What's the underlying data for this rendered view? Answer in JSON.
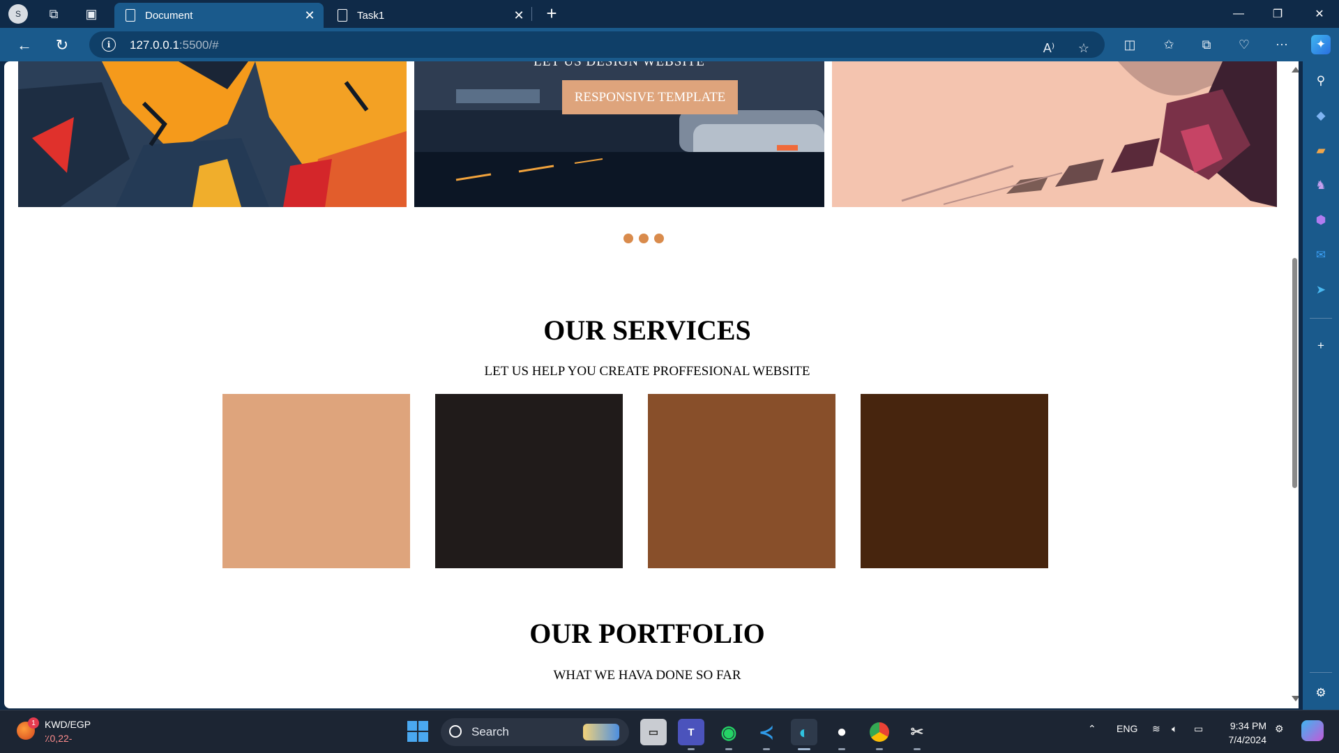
{
  "browser": {
    "profile_initial": "S",
    "tabs": [
      {
        "title": "Document",
        "active": true
      },
      {
        "title": "Task1",
        "active": false
      }
    ],
    "url_host": "127.0.0.1",
    "url_rest": ":5500/#"
  },
  "page": {
    "slider": {
      "slide_title": "LET US DESIGN WEBSITE",
      "button_label": "RESPONSIVE TEMPLATE",
      "dot_count": 3
    },
    "services": {
      "title": "OUR SERVICES",
      "subtitle": "LET US HELP YOU CREATE PROFFESIONAL WEBSITE",
      "box_colors": [
        "#dea47c",
        "#201b1a",
        "#884f2a",
        "#47250e"
      ]
    },
    "portfolio": {
      "title": "OUR PORTFOLIO",
      "subtitle": "WHAT WE HAVA DONE SO FAR"
    }
  },
  "taskbar": {
    "widget_badge": "1",
    "widget_title": "KWD/EGP",
    "widget_value": "٪0,22-",
    "search_label": "Search",
    "language": "ENG",
    "time": "9:34 PM",
    "date": "7/4/2024"
  }
}
